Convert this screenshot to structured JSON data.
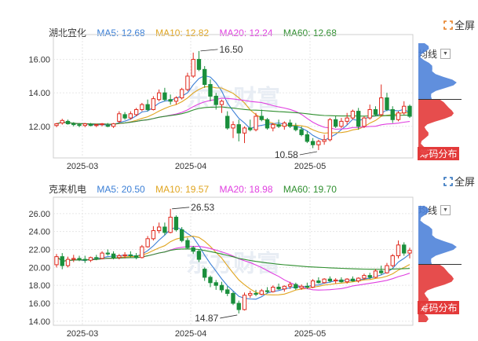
{
  "charts": [
    {
      "name": "湖北宜化",
      "ma": [
        {
          "label": "MA5: 12.68",
          "color": "#3b7fd6"
        },
        {
          "label": "MA10: 12.82",
          "color": "#e0a520"
        },
        {
          "label": "MA20: 12.24",
          "color": "#e040e0"
        },
        {
          "label": "MA60: 12.68",
          "color": "#2f8f2f"
        }
      ],
      "side_label": "均线",
      "dist_button": "筹码分布",
      "fullscreen": "全屏",
      "watermark": "东方财富",
      "high_label": "16.50",
      "low_label": "10.58"
    },
    {
      "name": "克来机电",
      "ma": [
        {
          "label": "MA5: 20.50",
          "color": "#3b7fd6"
        },
        {
          "label": "MA10: 19.57",
          "color": "#e0a520"
        },
        {
          "label": "MA20: 18.98",
          "color": "#e040e0"
        },
        {
          "label": "MA60: 19.70",
          "color": "#2f8f2f"
        }
      ],
      "side_label": "均线",
      "dist_button": "筹码分布",
      "fullscreen": "全屏",
      "watermark": "东方财富",
      "high_label": "26.53",
      "low_label": "14.87"
    }
  ],
  "chart_data": [
    {
      "type": "candlestick",
      "title": "湖北宜化",
      "x_ticks": [
        "2025-03",
        "2025-04",
        "2025-05"
      ],
      "y_ticks": [
        "16.00",
        "14.00",
        "12.00"
      ],
      "ylim": [
        10.3,
        17.2
      ],
      "high": 16.5,
      "low": 10.58,
      "ohlc": [
        [
          12.05,
          12.2,
          11.95,
          12.15
        ],
        [
          12.2,
          12.45,
          12.1,
          12.35
        ],
        [
          12.3,
          12.4,
          12.1,
          12.15
        ],
        [
          12.15,
          12.25,
          12.0,
          12.1
        ],
        [
          12.1,
          12.2,
          11.95,
          12.05
        ],
        [
          12.05,
          12.2,
          11.95,
          12.15
        ],
        [
          12.1,
          12.2,
          12.0,
          12.05
        ],
        [
          12.05,
          12.15,
          11.95,
          12.1
        ],
        [
          12.1,
          12.2,
          12.0,
          12.15
        ],
        [
          12.05,
          12.2,
          11.95,
          12.0
        ],
        [
          12.0,
          12.2,
          11.9,
          12.15
        ],
        [
          12.3,
          12.9,
          12.2,
          12.75
        ],
        [
          12.7,
          12.85,
          12.4,
          12.5
        ],
        [
          12.5,
          12.9,
          12.4,
          12.75
        ],
        [
          12.7,
          13.1,
          12.6,
          13.0
        ],
        [
          13.0,
          13.4,
          12.9,
          13.3
        ],
        [
          13.3,
          13.6,
          12.9,
          13.0
        ],
        [
          13.0,
          13.8,
          12.95,
          13.65
        ],
        [
          13.6,
          14.2,
          13.5,
          14.0
        ],
        [
          14.0,
          14.3,
          13.5,
          13.6
        ],
        [
          13.6,
          13.9,
          13.3,
          13.5
        ],
        [
          13.5,
          13.8,
          13.3,
          13.7
        ],
        [
          13.7,
          14.3,
          13.6,
          14.2
        ],
        [
          14.2,
          15.2,
          14.1,
          15.0
        ],
        [
          15.0,
          16.4,
          14.9,
          16.0
        ],
        [
          16.0,
          16.5,
          15.3,
          15.4
        ],
        [
          15.4,
          15.6,
          14.3,
          14.5
        ],
        [
          14.5,
          14.8,
          13.5,
          13.8
        ],
        [
          13.8,
          14.0,
          13.0,
          13.3
        ],
        [
          13.3,
          13.6,
          12.8,
          13.5
        ],
        [
          12.6,
          12.9,
          11.8,
          11.9
        ],
        [
          11.9,
          12.3,
          11.3,
          12.1
        ],
        [
          12.1,
          12.4,
          11.1,
          11.6
        ],
        [
          11.6,
          12.0,
          11.0,
          11.9
        ],
        [
          11.9,
          12.4,
          11.7,
          11.8
        ],
        [
          11.8,
          12.8,
          11.7,
          12.6
        ],
        [
          12.6,
          13.0,
          12.3,
          12.4
        ],
        [
          12.4,
          12.5,
          11.8,
          11.9
        ],
        [
          11.9,
          12.2,
          11.7,
          12.1
        ],
        [
          12.1,
          12.4,
          11.9,
          12.0
        ],
        [
          12.0,
          12.3,
          11.8,
          12.2
        ],
        [
          12.2,
          12.4,
          11.9,
          12.0
        ],
        [
          12.0,
          12.2,
          11.7,
          11.8
        ],
        [
          11.8,
          12.0,
          11.4,
          11.5
        ],
        [
          11.5,
          11.7,
          11.0,
          11.1
        ],
        [
          11.1,
          11.3,
          10.7,
          10.9
        ],
        [
          10.9,
          11.2,
          10.58,
          11.1
        ],
        [
          11.1,
          11.5,
          10.9,
          11.2
        ],
        [
          11.2,
          12.5,
          11.1,
          12.4
        ],
        [
          12.4,
          12.6,
          11.9,
          12.0
        ],
        [
          12.0,
          12.5,
          11.9,
          12.3
        ],
        [
          12.3,
          12.8,
          12.1,
          12.5
        ],
        [
          12.5,
          13.0,
          12.4,
          12.9
        ],
        [
          12.9,
          13.1,
          11.8,
          12.0
        ],
        [
          12.0,
          12.6,
          11.9,
          12.5
        ],
        [
          12.5,
          13.3,
          12.4,
          13.0
        ],
        [
          13.0,
          13.2,
          12.6,
          12.7
        ],
        [
          12.7,
          14.5,
          12.6,
          13.7
        ],
        [
          13.7,
          14.0,
          12.9,
          13.0
        ],
        [
          13.0,
          13.2,
          12.2,
          12.4
        ],
        [
          12.4,
          12.9,
          12.3,
          12.8
        ],
        [
          12.8,
          13.5,
          12.7,
          13.2
        ],
        [
          13.2,
          13.3,
          12.5,
          12.6
        ]
      ]
    },
    {
      "type": "candlestick",
      "title": "克来机电",
      "x_ticks": [
        "2025-03",
        "2025-04",
        "2025-05"
      ],
      "y_ticks": [
        "26.00",
        "24.00",
        "22.00",
        "20.00",
        "18.00",
        "16.00",
        "14.00"
      ],
      "ylim": [
        13.9,
        27.3
      ],
      "high": 26.53,
      "low": 14.87,
      "ohlc": [
        [
          20.3,
          21.5,
          20.0,
          21.2
        ],
        [
          21.2,
          21.6,
          19.8,
          20.2
        ],
        [
          20.2,
          21.2,
          20.0,
          20.9
        ],
        [
          20.9,
          21.4,
          20.6,
          21.0
        ],
        [
          21.0,
          21.3,
          20.7,
          20.9
        ],
        [
          20.9,
          21.3,
          20.5,
          20.8
        ],
        [
          20.8,
          21.2,
          20.6,
          21.1
        ],
        [
          21.1,
          21.4,
          20.8,
          21.0
        ],
        [
          21.0,
          21.8,
          20.9,
          21.6
        ],
        [
          21.6,
          22.0,
          21.3,
          21.5
        ],
        [
          21.5,
          21.8,
          20.9,
          21.1
        ],
        [
          21.1,
          21.5,
          20.9,
          21.3
        ],
        [
          21.3,
          21.7,
          21.0,
          21.4
        ],
        [
          21.4,
          21.8,
          21.1,
          21.3
        ],
        [
          21.3,
          21.6,
          20.9,
          21.1
        ],
        [
          21.1,
          22.5,
          21.0,
          22.3
        ],
        [
          22.3,
          23.5,
          22.2,
          23.2
        ],
        [
          23.2,
          24.6,
          23.0,
          24.1
        ],
        [
          24.1,
          25.0,
          23.8,
          24.5
        ],
        [
          24.5,
          25.0,
          23.6,
          23.9
        ],
        [
          23.9,
          26.53,
          23.8,
          25.6
        ],
        [
          25.6,
          25.8,
          24.0,
          24.2
        ],
        [
          24.2,
          24.5,
          22.8,
          23.0
        ],
        [
          23.0,
          23.3,
          22.0,
          22.2
        ],
        [
          22.2,
          22.4,
          21.5,
          21.8
        ],
        [
          21.8,
          22.0,
          20.6,
          20.9
        ],
        [
          19.8,
          20.0,
          18.5,
          18.9
        ],
        [
          18.9,
          19.1,
          17.8,
          18.3
        ],
        [
          18.3,
          18.6,
          17.5,
          18.0
        ],
        [
          18.0,
          18.4,
          17.2,
          17.5
        ],
        [
          17.5,
          17.9,
          16.8,
          17.1
        ],
        [
          17.1,
          17.3,
          15.8,
          16.0
        ],
        [
          16.0,
          16.3,
          14.87,
          15.3
        ],
        [
          15.3,
          17.2,
          15.2,
          16.9
        ],
        [
          16.9,
          17.4,
          16.6,
          17.1
        ],
        [
          17.1,
          17.5,
          16.8,
          17.0
        ],
        [
          17.0,
          17.6,
          16.9,
          17.4
        ],
        [
          17.4,
          17.8,
          17.1,
          17.3
        ],
        [
          17.3,
          18.0,
          17.2,
          17.8
        ],
        [
          17.8,
          18.2,
          17.5,
          17.6
        ],
        [
          17.6,
          18.0,
          17.3,
          17.9
        ],
        [
          17.9,
          18.4,
          17.6,
          18.1
        ],
        [
          18.1,
          18.3,
          17.5,
          17.7
        ],
        [
          17.7,
          18.1,
          17.5,
          17.9
        ],
        [
          17.9,
          18.3,
          17.6,
          17.8
        ],
        [
          17.8,
          18.7,
          17.7,
          18.5
        ],
        [
          18.5,
          18.9,
          18.2,
          18.3
        ],
        [
          18.3,
          18.8,
          18.2,
          18.7
        ],
        [
          18.7,
          19.0,
          18.3,
          18.5
        ],
        [
          18.5,
          18.8,
          18.2,
          18.6
        ],
        [
          18.6,
          18.9,
          18.3,
          18.4
        ],
        [
          18.4,
          18.8,
          18.2,
          18.7
        ],
        [
          18.7,
          19.0,
          18.4,
          18.5
        ],
        [
          18.5,
          18.9,
          18.3,
          18.8
        ],
        [
          18.8,
          19.3,
          18.6,
          19.1
        ],
        [
          19.1,
          19.4,
          18.7,
          18.9
        ],
        [
          18.9,
          19.8,
          18.8,
          19.6
        ],
        [
          19.6,
          20.2,
          19.2,
          19.4
        ],
        [
          19.4,
          20.5,
          19.3,
          20.2
        ],
        [
          20.2,
          21.5,
          20.0,
          21.3
        ],
        [
          21.3,
          23.0,
          21.0,
          22.5
        ],
        [
          22.5,
          22.8,
          21.3,
          21.6
        ],
        [
          21.6,
          22.2,
          21.0,
          21.9
        ]
      ]
    }
  ]
}
